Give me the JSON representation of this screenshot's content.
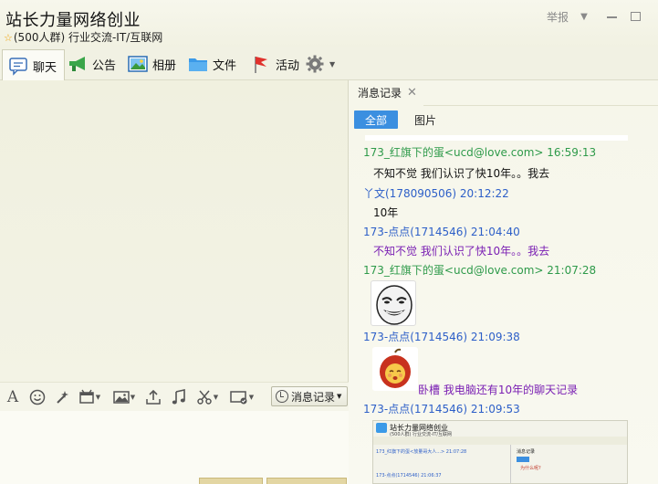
{
  "window": {
    "group_name": "站长力量网络创业",
    "group_meta": "(500人群) 行业交流-IT/互联网",
    "report_label": "举报"
  },
  "toolbar": {
    "chat": "聊天",
    "notice": "公告",
    "album": "相册",
    "files": "文件",
    "activity": "活动"
  },
  "input_toolbar": {
    "history_button": "消息记录"
  },
  "history_panel": {
    "tab_label": "消息记录",
    "filter_all": "全部",
    "filter_images": "图片",
    "messages": [
      {
        "sender": "173_红旗下的蛋<ucd@love.com>",
        "time": "16:59:13",
        "text": "不知不觉 我们认识了快10年。。我去"
      },
      {
        "sender": "丫文(178090506)",
        "time": "20:12:22",
        "text": "10年"
      },
      {
        "sender": "173-点点(1714546)",
        "time": "21:04:40",
        "text": "不知不觉 我们认识了快10年。。我去"
      },
      {
        "sender": "173_红旗下的蛋<ucd@love.com>",
        "time": "21:07:28"
      },
      {
        "sender": "173-点点(1714546)",
        "time": "21:09:38",
        "text": "卧槽 我电脑还有10年的聊天记录"
      },
      {
        "sender": "173-点点(1714546)",
        "time": "21:09:53"
      }
    ],
    "embedded_screenshot": {
      "title": "站长力量网络创业",
      "sub": "(500人群) 行业交流-IT/互联网",
      "line1": "173_红旗下的蛋<放量哥大人...> 21:07:28",
      "line2": "173-点点(1714546) 21:06:37",
      "panel_label": "消息记录",
      "red_note": "为什么呢?"
    }
  },
  "colors": {
    "accent": "#3b8fe0",
    "green_sender": "#2e9a4a",
    "blue_sender": "#2d5fc8",
    "purple_text": "#7a1fb3"
  }
}
